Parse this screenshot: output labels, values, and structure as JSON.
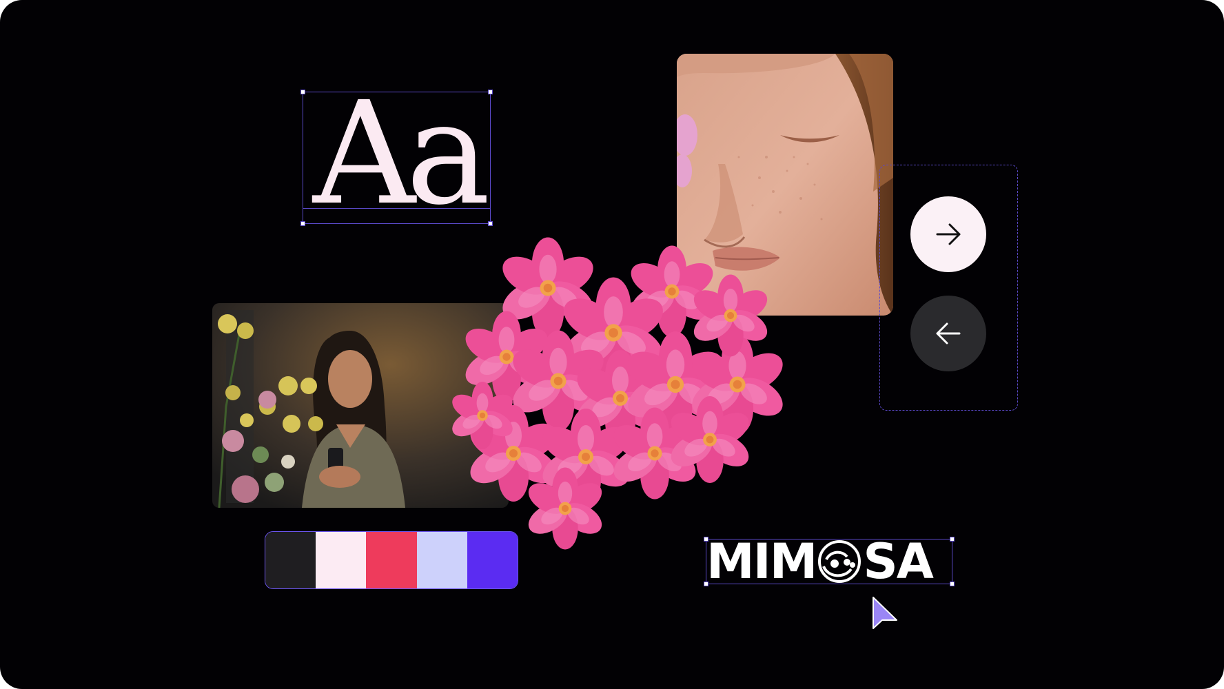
{
  "type_sample": {
    "glyphs": "Aa"
  },
  "images": {
    "portrait": "portrait-photo",
    "phone": "woman-with-phone-photo",
    "flowers": "pink-flower-cluster"
  },
  "nav": {
    "next_icon": "arrow-right-icon",
    "prev_icon": "arrow-left-icon"
  },
  "palette": {
    "swatches": [
      "#1f1e21",
      "#fcebf3",
      "#ee3b5c",
      "#cdd1fb",
      "#5b2cf2"
    ]
  },
  "logo": {
    "text_before": "MIM",
    "text_after": "SA",
    "mark_icon": "spiral-o-icon"
  },
  "colors": {
    "background": "#020104",
    "accent": "#5b49c9",
    "cursor": "#9a86f5"
  }
}
